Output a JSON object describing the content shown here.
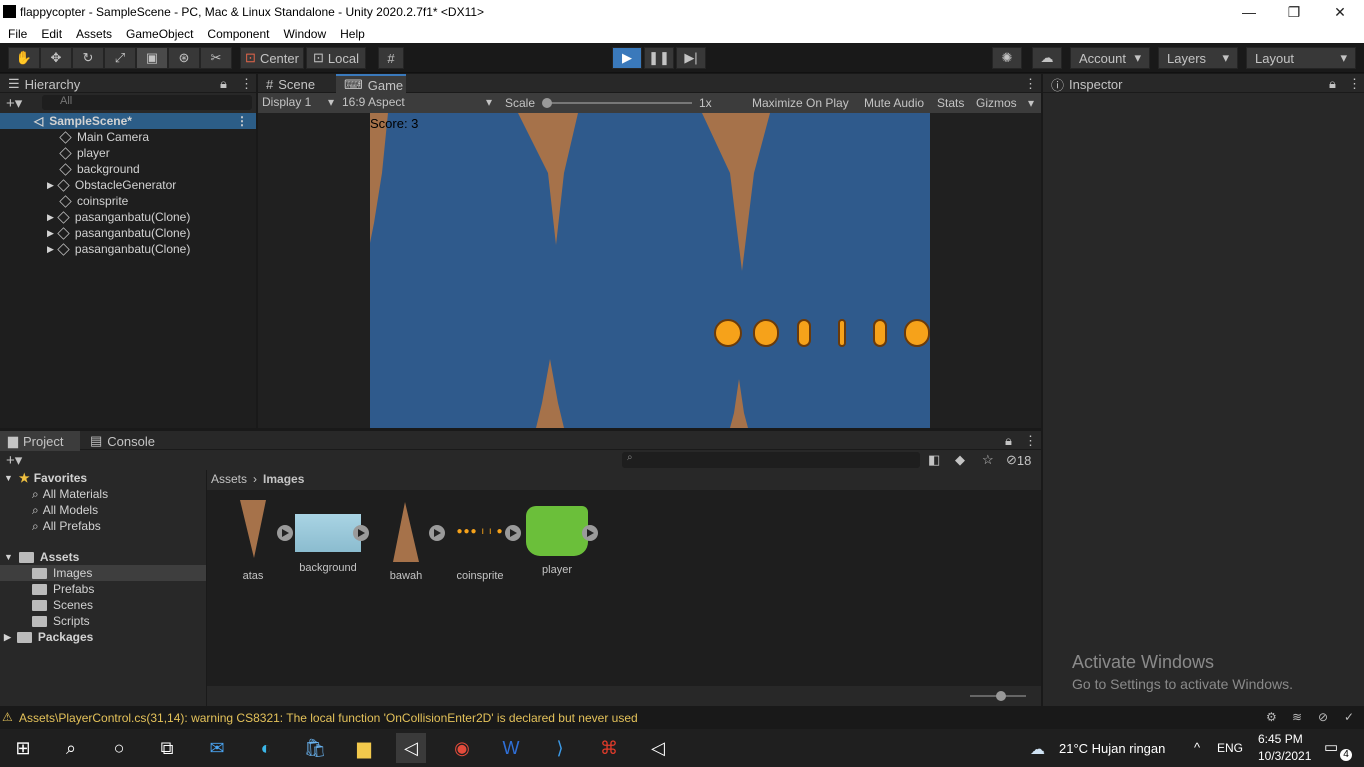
{
  "window": {
    "title": "flappycopter - SampleScene - PC, Mac & Linux Standalone - Unity 2020.2.7f1* <DX11>"
  },
  "menu": [
    "File",
    "Edit",
    "Assets",
    "GameObject",
    "Component",
    "Window",
    "Help"
  ],
  "toolbar": {
    "pivot": "Center",
    "space": "Local",
    "account": "Account",
    "layers": "Layers",
    "layout": "Layout"
  },
  "hierarchy": {
    "tab": "Hierarchy",
    "search_placeholder": "All",
    "scene": "SampleScene*",
    "items": [
      "Main Camera",
      "player",
      "background",
      "ObstacleGenerator",
      "coinsprite",
      "pasanganbatu(Clone)",
      "pasanganbatu(Clone)",
      "pasanganbatu(Clone)"
    ]
  },
  "game": {
    "tabs": [
      "Scene",
      "Game"
    ],
    "display": "Display 1",
    "aspect": "16:9 Aspect",
    "scale_label": "Scale",
    "scale_value": "1x",
    "options": [
      "Maximize On Play",
      "Mute Audio",
      "Stats",
      "Gizmos"
    ],
    "score": "Score: 3"
  },
  "inspector": {
    "tab": "Inspector"
  },
  "project": {
    "tabs": [
      "Project",
      "Console"
    ],
    "hidden_count": "18",
    "breadcrumb": [
      "Assets",
      "Images"
    ],
    "favorites_label": "Favorites",
    "favorites": [
      "All Materials",
      "All Models",
      "All Prefabs"
    ],
    "assets_label": "Assets",
    "folders": [
      "Images",
      "Prefabs",
      "Scenes",
      "Scripts"
    ],
    "packages_label": "Packages",
    "assets": [
      "atas",
      "background",
      "bawah",
      "coinsprite",
      "player"
    ]
  },
  "watermark": {
    "line1": "Activate Windows",
    "line2": "Go to Settings to activate Windows."
  },
  "status": {
    "message": "Assets\\PlayerControl.cs(31,14): warning CS8321: The local function 'OnCollisionEnter2D' is declared but never used"
  },
  "taskbar": {
    "weather": "21°C  Hujan ringan",
    "lang": "ENG",
    "time": "6:45 PM",
    "date": "10/3/2021",
    "notif": "4"
  },
  "colors": {
    "sky": "#2f5a8c",
    "rock": "#a6724a",
    "coin": "#f6a21a",
    "play_accent": "#3a79bb"
  }
}
